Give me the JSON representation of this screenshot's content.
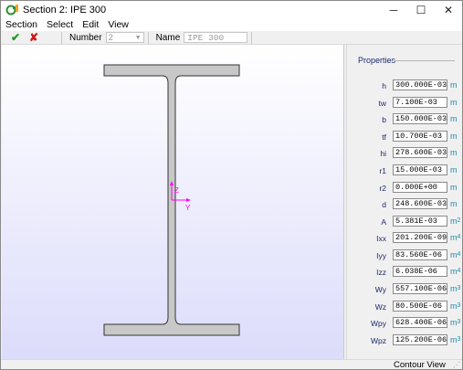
{
  "window": {
    "title": "Section 2: IPE 300",
    "controls": {
      "minimize": "─",
      "maximize": "☐",
      "close": "✕"
    }
  },
  "menu": [
    "Section",
    "Select",
    "Edit",
    "View"
  ],
  "toolbar": {
    "accept_icon": "✔",
    "cancel_icon": "✘",
    "number_label": "Number",
    "number_value": "2",
    "name_label": "Name",
    "name_value": "IPE 300"
  },
  "canvas": {
    "axis_z": "Z",
    "axis_y": "Y",
    "section_color": "#c8c8c8",
    "axis_color": "#ff00ff"
  },
  "properties": {
    "title": "Properties",
    "rows": [
      {
        "label": "h",
        "value": "300.000E-03",
        "unit": "m",
        "exp": ""
      },
      {
        "label": "tw",
        "value": "7.100E-03",
        "unit": "m",
        "exp": ""
      },
      {
        "label": "b",
        "value": "150.000E-03",
        "unit": "m",
        "exp": ""
      },
      {
        "label": "tf",
        "value": "10.700E-03",
        "unit": "m",
        "exp": ""
      },
      {
        "label": "hi",
        "value": "278.600E-03",
        "unit": "m",
        "exp": ""
      },
      {
        "label": "r1",
        "value": "15.000E-03",
        "unit": "m",
        "exp": ""
      },
      {
        "label": "r2",
        "value": "0.000E+00",
        "unit": "m",
        "exp": ""
      },
      {
        "label": "d",
        "value": "248.600E-03",
        "unit": "m",
        "exp": ""
      },
      {
        "label": "A",
        "value": "5.381E-03",
        "unit": "m",
        "exp": "2"
      },
      {
        "label": "Ixx",
        "value": "201.200E-09",
        "unit": "m",
        "exp": "4"
      },
      {
        "label": "Iyy",
        "value": "83.560E-06",
        "unit": "m",
        "exp": "4"
      },
      {
        "label": "Izz",
        "value": "6.038E-06",
        "unit": "m",
        "exp": "4"
      },
      {
        "label": "Wy",
        "value": "557.100E-06",
        "unit": "m",
        "exp": "3"
      },
      {
        "label": "Wz",
        "value": "80.500E-06",
        "unit": "m",
        "exp": "3"
      },
      {
        "label": "Wpy",
        "value": "628.400E-06",
        "unit": "m",
        "exp": "3"
      },
      {
        "label": "Wpz",
        "value": "125.200E-06",
        "unit": "m",
        "exp": "3"
      }
    ]
  },
  "status": {
    "text": "Contour View"
  }
}
